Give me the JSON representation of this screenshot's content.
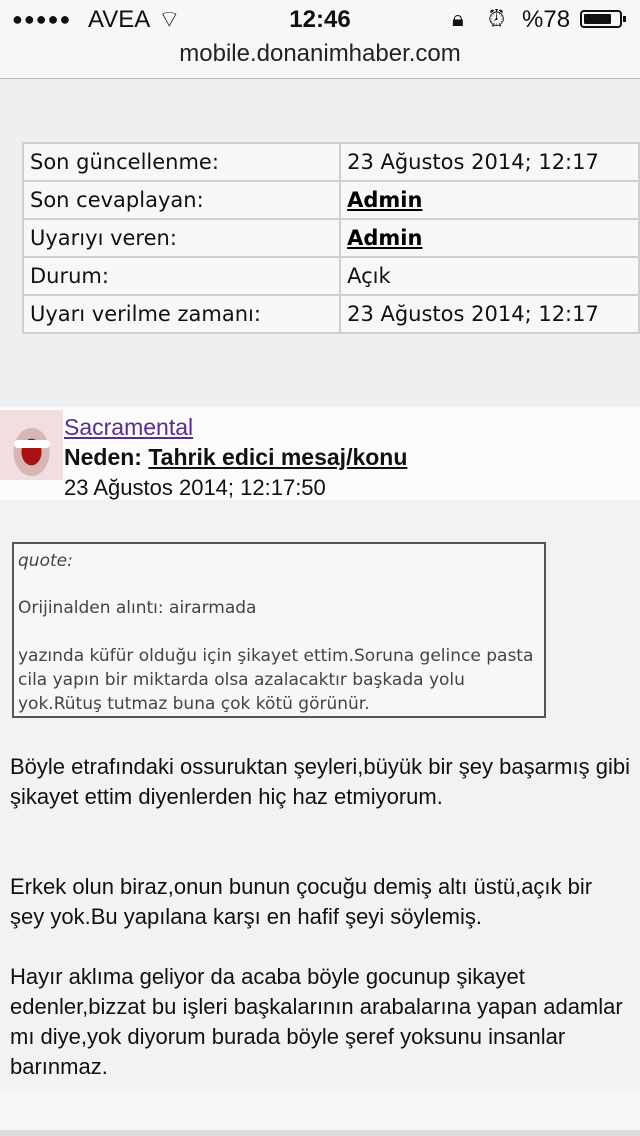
{
  "status_bar": {
    "carrier": "AVEA",
    "signal": "●●●●●",
    "time": "12:46",
    "battery_percent": "%78",
    "battery_level": 0.78
  },
  "browser": {
    "url": "mobile.donanimhaber.com"
  },
  "info_table": [
    {
      "label": "Son güncellenme:",
      "value": "23 Ağustos 2014; 12:17"
    },
    {
      "label": "Son cevaplayan:",
      "value": "Admin"
    },
    {
      "label": "Uyarıyı veren:",
      "value": "Admin"
    },
    {
      "label": "Durum:",
      "value": "Açık"
    },
    {
      "label": "Uyarı verilme zamanı:",
      "value": "23 Ağustos 2014; 12:17"
    }
  ],
  "post": {
    "author": "Sacramental",
    "reason_label": "Neden:",
    "reason": "Tahrik edici mesaj/konu",
    "date": "23 Ağustos 2014; 12:17:50",
    "quote_header": "quote:",
    "quote_source": "Orijinalden alıntı: airarmada",
    "quote_text": "yazında küfür olduğu için şikayet ettim.Soruna gelince pasta cila yapın bir miktarda olsa azalacaktır başkada yolu yok.Rütuş tutmaz buna çok kötü görünür.",
    "paragraphs": [
      "Böyle etrafındaki ossuruktan şeyleri,büyük bir şey başarmış gibi şikayet ettim diyenlerden hiç haz etmiyorum.",
      "Erkek olun biraz,onun bunun çocuğu demiş altı üstü,açık bir şey yok.Bu yapılana karşı en hafif şeyi söylemiş.",
      "Hayır aklıma geliyor da acaba böyle gocunup şikayet edenler,bizzat bu işleri başkalarının arabalarına yapan adamlar mı diye,yok diyorum burada böyle şeref yoksunu insanlar barınmaz."
    ]
  }
}
